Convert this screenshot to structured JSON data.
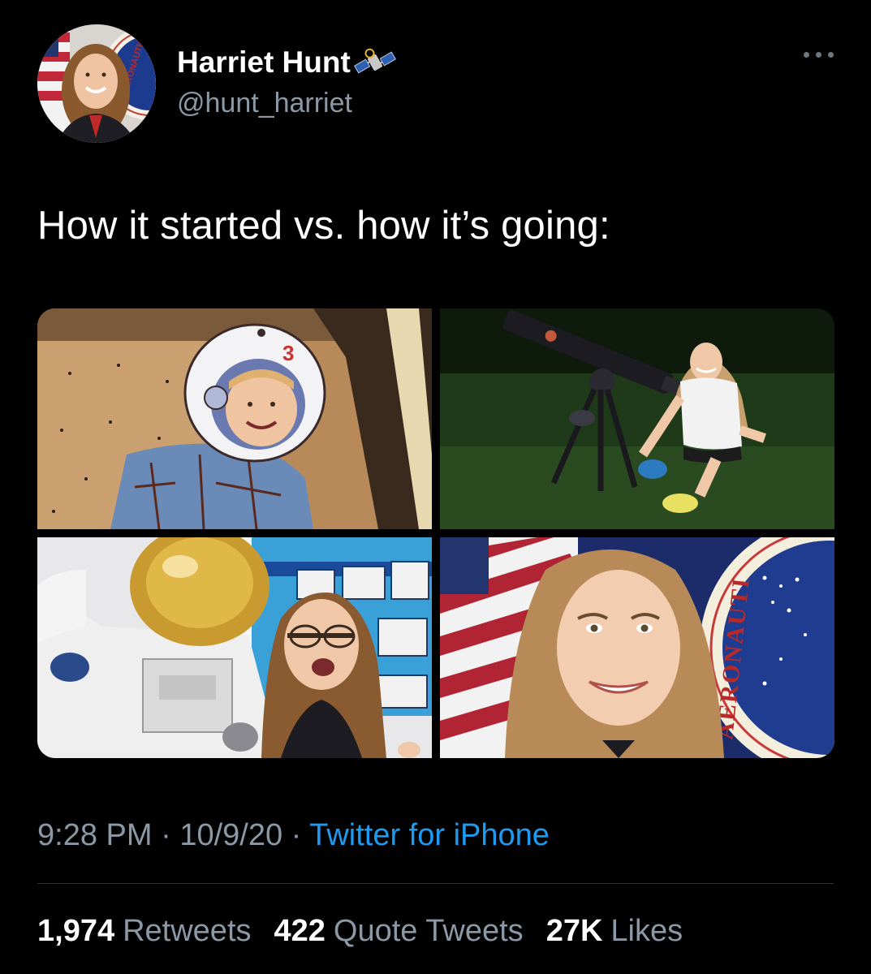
{
  "author": {
    "display_name": "Harriet Hunt",
    "handle": "@hunt_harriet",
    "badge_icon": "satellite-emoji",
    "avatar_seal_text": "AERONAUTIC"
  },
  "tweet": {
    "text": "How it started vs. how it’s going:"
  },
  "media": {
    "photo_1": {
      "helmet_number": "3"
    },
    "photo_4": {
      "seal_text": "AERONAUTI"
    }
  },
  "meta": {
    "time": "9:28 PM",
    "separator": "·",
    "date": "10/9/20",
    "source": "Twitter for iPhone"
  },
  "stats": {
    "retweets_count": "1,974",
    "retweets_label": "Retweets",
    "quotes_count": "422",
    "quotes_label": "Quote Tweets",
    "likes_count": "27K",
    "likes_label": "Likes"
  },
  "colors": {
    "background": "#000000",
    "text": "#ffffff",
    "secondary_text": "#8b98a5",
    "link": "#1d9bf0",
    "divider": "#2f3336"
  }
}
